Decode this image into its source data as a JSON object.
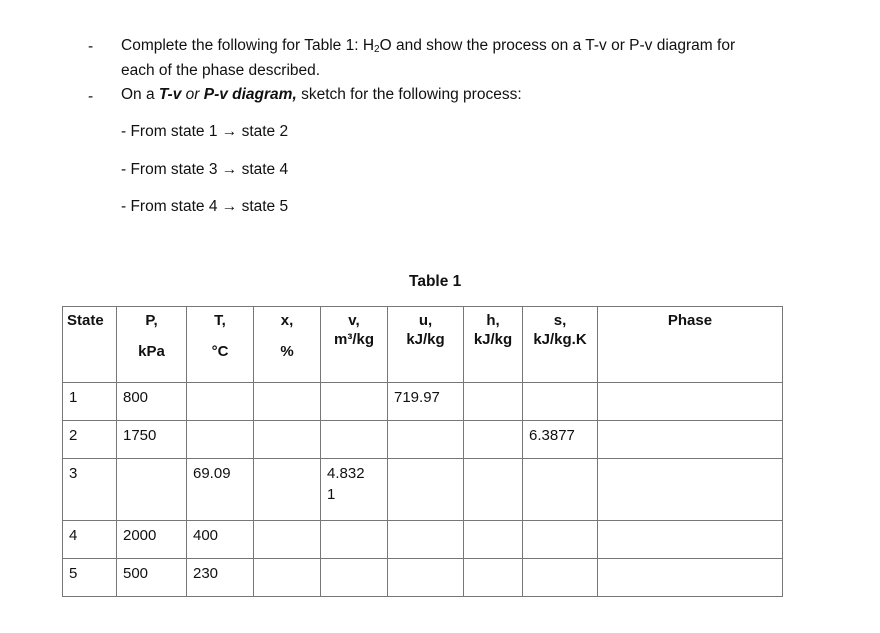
{
  "instructions": {
    "bullet_1": {
      "marker": "-",
      "line_1_prefix": "Complete the following for Table 1: H",
      "subscript": "2",
      "line_1_suffix": "O and show the process on a T-v or P-v diagram for",
      "line_2": "each of the phase described."
    },
    "bullet_2": {
      "marker": "-",
      "prefix": "On a ",
      "emph_1": "T-v",
      "mid": " or ",
      "emph_2": "P-v diagram,",
      "suffix": " sketch for the following process:"
    },
    "steps": [
      "- From state 1 → state 2",
      "- From state 3 → state 4",
      "- From state 4 → state 5"
    ]
  },
  "table": {
    "caption": "Table 1",
    "headers": [
      {
        "symbol": "State",
        "unit": ""
      },
      {
        "symbol": "P,",
        "unit": "kPa"
      },
      {
        "symbol": "T,",
        "unit": "°C"
      },
      {
        "symbol": "x,",
        "unit": "%"
      },
      {
        "symbol": "v,",
        "unit": "m³/kg"
      },
      {
        "symbol": "u,",
        "unit": "kJ/kg"
      },
      {
        "symbol": "h,",
        "unit": "kJ/kg"
      },
      {
        "symbol": "s,",
        "unit": "kJ/kg.K"
      },
      {
        "symbol": "Phase",
        "unit": ""
      }
    ],
    "rows": [
      {
        "state": "1",
        "P": "800",
        "T": "",
        "x": "",
        "v": "",
        "u": "719.97",
        "h": "",
        "s": "",
        "phase": ""
      },
      {
        "state": "2",
        "P": "1750",
        "T": "",
        "x": "",
        "v": "",
        "u": "",
        "h": "",
        "s": "6.3877",
        "phase": ""
      },
      {
        "state": "3",
        "P": "",
        "T": "69.09",
        "x": "",
        "v_line_1": "4.832",
        "v_line_2": "1",
        "u": "",
        "h": "",
        "s": "",
        "phase": ""
      },
      {
        "state": "4",
        "P": "2000",
        "T": "400",
        "x": "",
        "v": "",
        "u": "",
        "h": "",
        "s": "",
        "phase": ""
      },
      {
        "state": "5",
        "P": "500",
        "T": "230",
        "x": "",
        "v": "",
        "u": "",
        "h": "",
        "s": "",
        "phase": ""
      }
    ]
  }
}
